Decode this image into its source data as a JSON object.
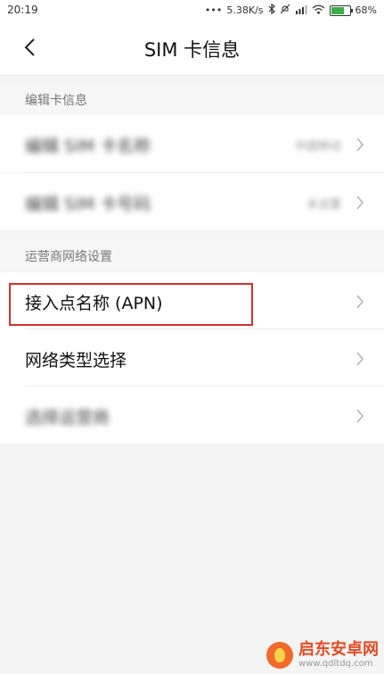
{
  "status_bar": {
    "time": "20:19",
    "speed": "5.38K/s",
    "battery": "68%",
    "battery_level": 0.68
  },
  "header": {
    "title": "SIM 卡信息"
  },
  "sections": {
    "edit_card": {
      "header": "编辑卡信息",
      "rows": [
        {
          "label": "编辑 SIM 卡名称",
          "value": "中国移动"
        },
        {
          "label": "编辑 SIM 卡号码",
          "value": "未设置"
        }
      ]
    },
    "carrier_network": {
      "header": "运营商网络设置",
      "rows": [
        {
          "label": "接入点名称 (APN)"
        },
        {
          "label": "网络类型选择"
        },
        {
          "label": "选择运营商"
        }
      ]
    }
  },
  "watermark": {
    "title": "启东安卓网",
    "url": "www.qdltdq.com"
  },
  "colors": {
    "highlight": "#d0322c",
    "accent": "#f06a2a"
  }
}
